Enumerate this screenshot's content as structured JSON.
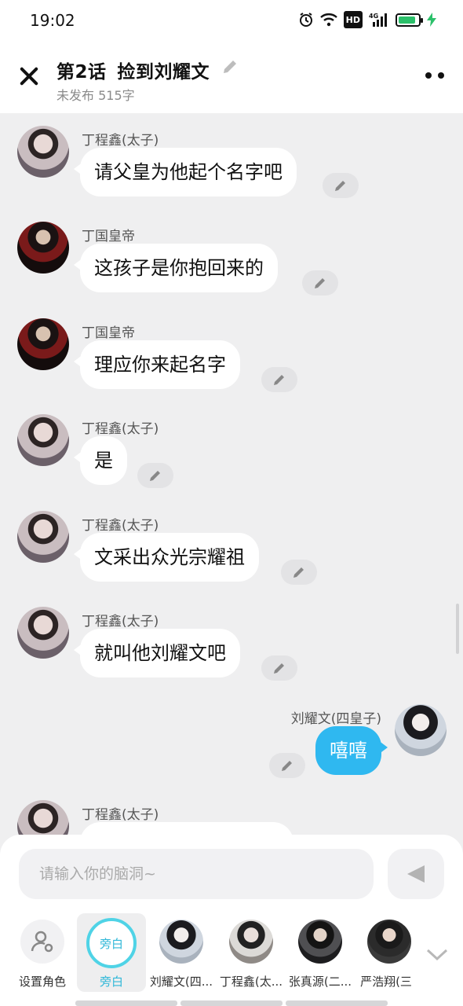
{
  "status_bar": {
    "time": "19:02",
    "icons": [
      "alarm-icon",
      "wifi-icon",
      "hd-icon",
      "4g-signal-icon",
      "battery-icon",
      "charging-icon"
    ],
    "hd_label": "HD",
    "net_label": "4G"
  },
  "header": {
    "title_part1": "第2话",
    "title_part2": "捡到刘耀文",
    "subtitle": "未发布 515字"
  },
  "messages": [
    {
      "speaker": "丁程鑫(太子)",
      "text": "请父皇为他起个名字吧",
      "side": "left"
    },
    {
      "speaker": "丁国皇帝",
      "text": "这孩子是你抱回来的",
      "side": "left"
    },
    {
      "speaker": "丁国皇帝",
      "text": "理应你来起名字",
      "side": "left"
    },
    {
      "speaker": "丁程鑫(太子)",
      "text": "是",
      "side": "left"
    },
    {
      "speaker": "丁程鑫(太子)",
      "text": "文采出众光宗耀祖",
      "side": "left"
    },
    {
      "speaker": "丁程鑫(太子)",
      "text": "就叫他刘耀文吧",
      "side": "left"
    },
    {
      "speaker": "刘耀文(四皇子)",
      "text": "嘻嘻",
      "side": "right"
    },
    {
      "speaker": "丁程鑫(太子)",
      "text": "",
      "side": "left"
    }
  ],
  "composer": {
    "placeholder": "请输入你的脑洞~"
  },
  "roles": [
    {
      "label": "设置角色"
    },
    {
      "label": "旁白",
      "ring_text": "旁白"
    },
    {
      "label": "刘耀文(四..."
    },
    {
      "label": "丁程鑫(太..."
    },
    {
      "label": "张真源(二..."
    },
    {
      "label": "严浩翔(三"
    }
  ],
  "colors": {
    "accent": "#2fb8f0",
    "selected_role": "#30b8d8",
    "charging": "#2bc06a"
  }
}
